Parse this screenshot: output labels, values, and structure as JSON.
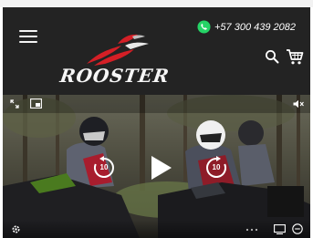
{
  "header": {
    "phone_number": "+57 300 439 2082",
    "logo_text": "ROOSTER"
  },
  "icons": {
    "menu": "hamburger-icon",
    "whatsapp": "whatsapp-icon",
    "search": "search-icon",
    "cart": "cart-icon",
    "expand": "expand-icon",
    "pip": "picture-in-picture-icon",
    "mute": "volume-mute-icon",
    "play": "play-icon",
    "rewind": "rewind-10-icon",
    "forward": "forward-10-icon",
    "settings": "settings-icon",
    "cast": "cast-icon",
    "more": "more-icon"
  },
  "video": {
    "rewind_label": "10",
    "forward_label": "10"
  },
  "colors": {
    "header_bg": "#232323",
    "whatsapp_green": "#25d366",
    "logo_red": "#d41f26"
  }
}
